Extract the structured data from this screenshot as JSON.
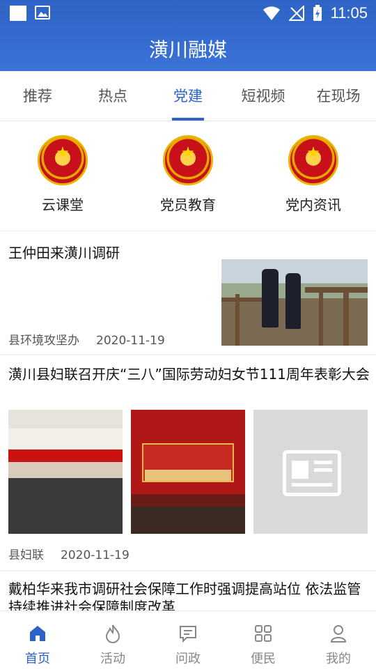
{
  "status_bar": {
    "time": "11:05"
  },
  "app": {
    "title": "潢川融媒"
  },
  "tabs": [
    {
      "label": "推荐",
      "active": false
    },
    {
      "label": "热点",
      "active": false
    },
    {
      "label": "党建",
      "active": true
    },
    {
      "label": "短视频",
      "active": false
    },
    {
      "label": "在现场",
      "active": false
    }
  ],
  "quick_links": [
    {
      "label": "云课堂",
      "icon": "national-emblem-icon"
    },
    {
      "label": "党员教育",
      "icon": "national-emblem-icon"
    },
    {
      "label": "党内资讯",
      "icon": "national-emblem-icon"
    }
  ],
  "news": [
    {
      "title": "王仲田来潢川调研",
      "source": "县环境攻坚办",
      "date": "2020-11-19"
    },
    {
      "title": "潢川县妇联召开庆“三八”国际劳动妇女节111周年表彰大会",
      "source": "县妇联",
      "date": "2020-11-19"
    },
    {
      "title": "戴柏华来我市调研社会保障工作时强调提高站位 依法监管 持续推进社会保障制度改革"
    }
  ],
  "bottom_nav": [
    {
      "label": "首页",
      "icon": "home-icon",
      "active": true
    },
    {
      "label": "活动",
      "icon": "flame-icon",
      "active": false
    },
    {
      "label": "问政",
      "icon": "message-icon",
      "active": false
    },
    {
      "label": "便民",
      "icon": "grid-icon",
      "active": false
    },
    {
      "label": "我的",
      "icon": "user-icon",
      "active": false
    }
  ],
  "colors": {
    "primary": "#2c63c9",
    "header": "#3b73d6"
  }
}
